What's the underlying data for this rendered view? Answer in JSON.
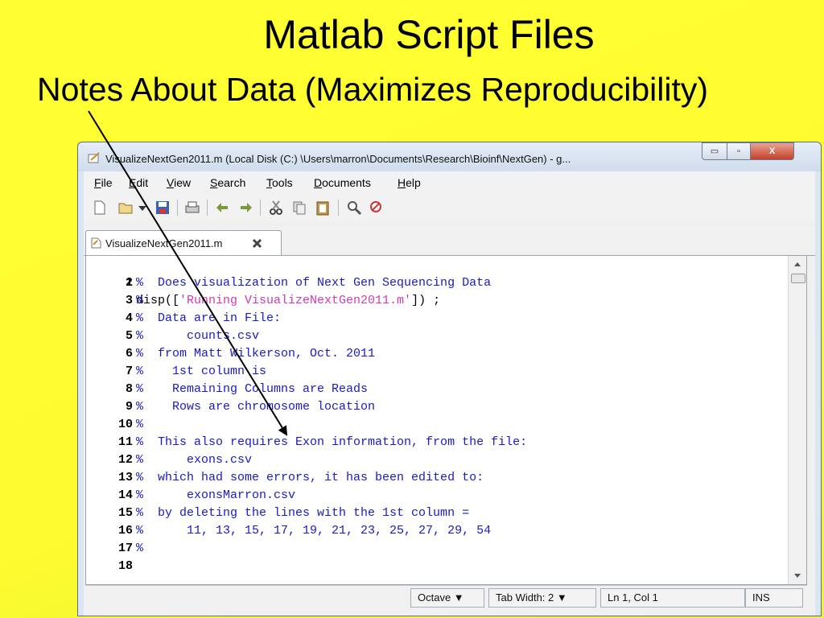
{
  "slide": {
    "title": "Matlab Script Files",
    "subtitle": "Notes About Data (Maximizes Reproducibility)"
  },
  "window": {
    "title": "VisualizeNextGen2011.m (Local Disk (C:) \\Users\\marron\\Documents\\Research\\Bioinf\\NextGen) - g...",
    "controls": {
      "minimize": "▭",
      "maximize": "▫",
      "close": "X"
    }
  },
  "menu": [
    "File",
    "Edit",
    "View",
    "Search",
    "Tools",
    "Documents",
    "Help"
  ],
  "toolbar_icons": [
    "new-file-icon",
    "open-folder-icon",
    "dropdown-arrow-icon",
    "save-icon",
    "print-icon",
    "undo-icon",
    "redo-icon",
    "cut-icon",
    "copy-icon",
    "paste-icon",
    "find-icon",
    "replace-icon"
  ],
  "tab": {
    "label": "VisualizeNextGen2011.m"
  },
  "code": {
    "line_numbers": [
      "1",
      "2",
      "3",
      "4",
      "5",
      "6",
      "7",
      "8",
      "9",
      "10",
      "11",
      "12",
      "13",
      "14",
      "15",
      "16",
      "17",
      "18"
    ],
    "line1": {
      "fn": "disp([",
      "str": "'Running VisualizeNextGen2011.m'",
      "end": "]) ;"
    },
    "lines": [
      "%  Does visualization of Next Gen Sequencing Data",
      "%",
      "%  Data are in File:",
      "%      counts.csv",
      "%  from Matt Wilkerson, Oct. 2011",
      "%    1st column is",
      "%    Remaining Columns are Reads",
      "%    Rows are chromosome location",
      "%",
      "%  This also requires Exon information, from the file:",
      "%      exons.csv",
      "%  which had some errors, it has been edited to:",
      "%      exonsMarron.csv",
      "%  by deleting the lines with the 1st column =",
      "%      11, 13, 15, 17, 19, 21, 23, 25, 27, 29, 54",
      "%",
      ""
    ]
  },
  "status": {
    "language": "Octave ▼",
    "tab_width": "Tab Width: 2 ▼",
    "position": "Ln 1, Col 1",
    "mode": "INS"
  }
}
